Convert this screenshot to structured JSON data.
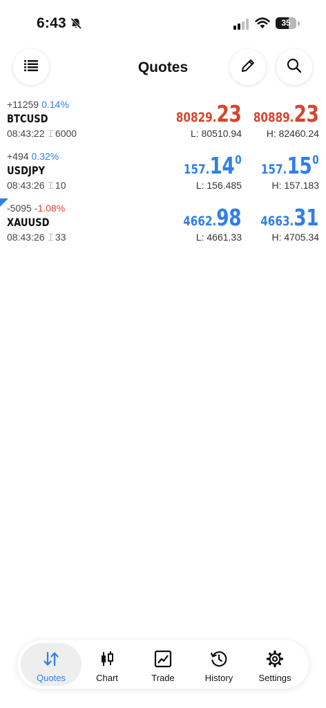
{
  "status_bar": {
    "time": "6:43",
    "battery": "35"
  },
  "header": {
    "title": "Quotes"
  },
  "colors": {
    "up": "#2f7fe8",
    "down": "#d8442e",
    "accent": "#2f7fe8"
  },
  "quotes": [
    {
      "symbol": "BTCUSD",
      "change_points": "+11259",
      "change_percent": "0.14%",
      "change_dir": "up",
      "time": "08:43:22",
      "spread": "6000",
      "bid": {
        "small": "80829.",
        "big": "23",
        "sup": ""
      },
      "bid_dir": "down",
      "ask": {
        "small": "80889.",
        "big": "23",
        "sup": ""
      },
      "ask_dir": "down",
      "low": "L: 80510.94",
      "high": "H: 82460.24"
    },
    {
      "symbol": "USDJPY",
      "change_points": "+494",
      "change_percent": "0.32%",
      "change_dir": "up",
      "time": "08:43:26",
      "spread": "10",
      "bid": {
        "small": "157.",
        "big": "14",
        "sup": "0"
      },
      "bid_dir": "up",
      "ask": {
        "small": "157.",
        "big": "15",
        "sup": "0"
      },
      "ask_dir": "up",
      "low": "L: 156.485",
      "high": "H: 157.183"
    },
    {
      "symbol": "XAUUSD",
      "change_points": "-5095",
      "change_percent": "-1.08%",
      "change_dir": "down",
      "time": "08:43:26",
      "spread": "33",
      "bid": {
        "small": "4662.",
        "big": "98",
        "sup": ""
      },
      "bid_dir": "up",
      "ask": {
        "small": "4663.",
        "big": "31",
        "sup": ""
      },
      "ask_dir": "up",
      "low": "L: 4661.33",
      "high": "H: 4705.34"
    }
  ],
  "tabs": [
    {
      "label": "Quotes",
      "icon": "quotes-arrows-icon",
      "active": true
    },
    {
      "label": "Chart",
      "icon": "candlestick-icon",
      "active": false
    },
    {
      "label": "Trade",
      "icon": "trade-chart-icon",
      "active": false
    },
    {
      "label": "History",
      "icon": "history-clock-icon",
      "active": false
    },
    {
      "label": "Settings",
      "icon": "gear-icon",
      "active": false
    }
  ]
}
